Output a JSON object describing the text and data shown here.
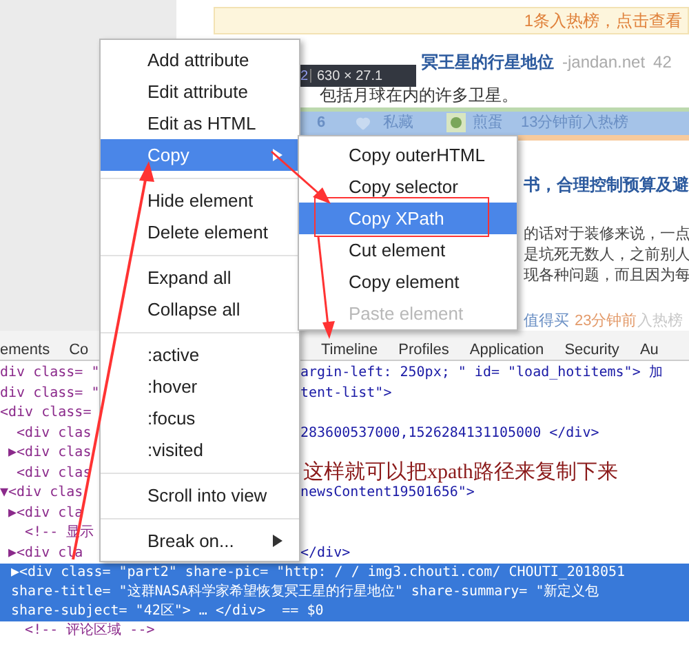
{
  "page": {
    "banner": "1条入热榜，点击查看",
    "article1": {
      "title": "冥王星的行星地位",
      "source": "-jandan.net",
      "count": "42",
      "summary": "包括月球在内的许多卫星。",
      "likes": "6",
      "save_label": "私藏",
      "user": "煎蛋",
      "time": "13分钟前入热榜"
    },
    "article2": {
      "title": "书，合理控制预算及避",
      "lines": [
        "的话对于装修来说，一点",
        "是坑死无数人，之前别人",
        "现各种问题，而且因为每"
      ],
      "source": "值得买",
      "time": "23分钟前",
      "time_suffix": "入热榜"
    }
  },
  "devtools": {
    "tabs": [
      {
        "label": "ements"
      },
      {
        "label": "Co"
      },
      {
        "label": "Timeline"
      },
      {
        "label": "Profiles"
      },
      {
        "label": "Application"
      },
      {
        "label": "Security"
      },
      {
        "label": "Au"
      }
    ],
    "rows": [
      {
        "left": "div class= \"",
        "right": "argin-left: 250px; \" id= \"load_hotitems\"> 加",
        "selected": false
      },
      {
        "left": "div class= \"",
        "right": "tent-list\">",
        "selected": false
      },
      {
        "left": "<div class=",
        "right": "",
        "selected": false
      },
      {
        "left": "  <div clas",
        "right": "283600537000,1526284131105000 </div>",
        "selected": false
      },
      {
        "left": " ▶<div clas",
        "right": "",
        "selected": false
      },
      {
        "left": "  <div clas",
        "right": "",
        "selected": false
      },
      {
        "left": "▼<div clas",
        "right": "newsContent19501656\">",
        "selected": false
      },
      {
        "left": " ▶<div cla",
        "right": "",
        "selected": false
      },
      {
        "left": "   <!-- 显示",
        "right": "",
        "selected": false
      },
      {
        "left": " ▶<div cla",
        "right": "</div>",
        "selected": false
      },
      {
        "left": "▶<div class= \"part2\" share-pic= \"http: / / img3.chouti.com/ CHOUTI_2018051",
        "right": "",
        "selected": true
      },
      {
        "left": "share-title= \"这群NASA科学家希望恢复冥王星的行星地位\" share-summary= \"新定义包",
        "right": "",
        "selected": true
      },
      {
        "left": "share-subject= \"42区\"> … </div>  == $0",
        "right": "",
        "selected": true
      },
      {
        "left": "   <!-- 评论区域 -->",
        "right": "",
        "selected": false
      }
    ]
  },
  "tooltip": {
    "prefix": "2",
    "dimensions": "630 × 27.1"
  },
  "context_menu": {
    "items": [
      {
        "kind": "item",
        "label": "Add attribute",
        "selected": false,
        "submenu": false
      },
      {
        "kind": "item",
        "label": "Edit attribute",
        "selected": false,
        "submenu": false
      },
      {
        "kind": "item",
        "label": "Edit as HTML",
        "selected": false,
        "submenu": false
      },
      {
        "kind": "item",
        "label": "Copy",
        "selected": true,
        "submenu": true
      },
      {
        "kind": "separator"
      },
      {
        "kind": "item",
        "label": "Hide element",
        "selected": false,
        "submenu": false
      },
      {
        "kind": "item",
        "label": "Delete element",
        "selected": false,
        "submenu": false
      },
      {
        "kind": "separator"
      },
      {
        "kind": "item",
        "label": "Expand all",
        "selected": false,
        "submenu": false
      },
      {
        "kind": "item",
        "label": "Collapse all",
        "selected": false,
        "submenu": false
      },
      {
        "kind": "separator"
      },
      {
        "kind": "item",
        "label": ":active",
        "selected": false,
        "submenu": false
      },
      {
        "kind": "item",
        "label": ":hover",
        "selected": false,
        "submenu": false
      },
      {
        "kind": "item",
        "label": ":focus",
        "selected": false,
        "submenu": false
      },
      {
        "kind": "item",
        "label": ":visited",
        "selected": false,
        "submenu": false
      },
      {
        "kind": "separator"
      },
      {
        "kind": "item",
        "label": "Scroll into view",
        "selected": false,
        "submenu": false
      },
      {
        "kind": "separator"
      },
      {
        "kind": "item",
        "label": "Break on...",
        "selected": false,
        "submenu": true
      }
    ]
  },
  "submenu": {
    "items": [
      {
        "label": "Copy outerHTML",
        "selected": false,
        "disabled": false
      },
      {
        "label": "Copy selector",
        "selected": false,
        "disabled": false
      },
      {
        "label": "Copy XPath",
        "selected": true,
        "disabled": false
      },
      {
        "label": "Cut element",
        "selected": false,
        "disabled": false
      },
      {
        "label": "Copy element",
        "selected": false,
        "disabled": false
      },
      {
        "label": "Paste element",
        "selected": false,
        "disabled": true
      }
    ]
  },
  "annotation": "这样就可以把xpath路径来复制下来"
}
